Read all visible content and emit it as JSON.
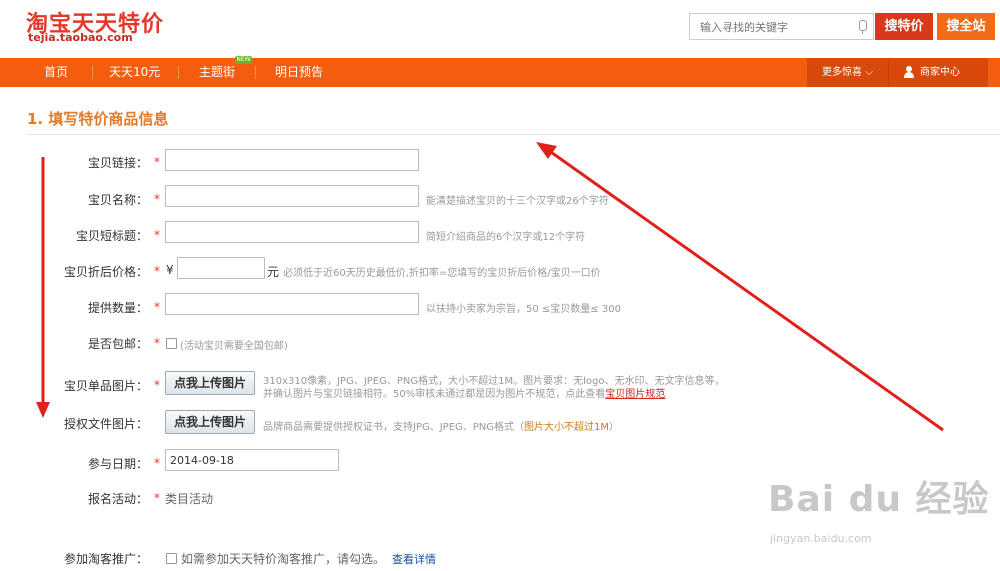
{
  "header": {
    "logo_cn": "淘宝天天特价",
    "logo_en": "tejia.taobao.com",
    "search_placeholder": "输入寻找的关键字",
    "btn_search_tejia": "搜特价",
    "btn_search_site": "搜全站"
  },
  "nav": {
    "items": [
      "首页",
      "天天10元",
      "主题街",
      "明日预告"
    ],
    "new_badge": "NEW",
    "more": "更多惊喜",
    "merchant": "商家中心"
  },
  "form": {
    "section_title": "1. 填写特价商品信息",
    "req_mark": "*",
    "currency": "¥",
    "yuan": "元",
    "labels": {
      "link": "宝贝链接：",
      "name": "宝贝名称：",
      "short_title": "宝贝短标题：",
      "price": "宝贝折后价格：",
      "quantity": "提供数量：",
      "shipping": "是否包邮：",
      "image": "宝贝单品图片：",
      "auth": "授权文件图片：",
      "date": "参与日期：",
      "activity": "报名活动：",
      "taoke": "参加淘客推广："
    },
    "hints": {
      "name": "能清楚描述宝贝的十三个汉字或26个字符",
      "short_title": "简短介绍商品的6个汉字或12个字符",
      "price": "必须低于近60天历史最低价,折扣率=您填写的宝贝折后价格/宝贝一口价",
      "quantity": "以扶持小卖家为宗旨，50 ≤宝贝数量≤ 300",
      "shipping": "(活动宝贝需要全国包邮)",
      "image_line1": "310x310像素，JPG、JPEG、PNG格式，大小不超过1M。图片要求：无logo、无水印、无文字信息等，",
      "image_line2": "并确认图片与宝贝链接相符。50%审核未通过都是因为图片不规范，点此查看",
      "image_link": "宝贝图片规范",
      "auth_prefix": "品牌商品需要提供授权证书，支持JPG、JPEG、PNG格式（",
      "auth_orange": "图片大小不超过1M",
      "auth_suffix": "）"
    },
    "upload_label": "点我上传图片",
    "date_value": "2014-09-18",
    "activity_value": "类目活动",
    "taoke_text": "如需参加天天特价淘客推广，请勾选。",
    "taoke_link": "查看详情"
  },
  "watermark": {
    "big": "Bai du 经验",
    "small": "jingyan.baidu.com"
  },
  "colors": {
    "nav_bg": "#f45d10",
    "accent": "#e4392a",
    "title": "#e07b2b",
    "arrow": "#e0211b"
  }
}
